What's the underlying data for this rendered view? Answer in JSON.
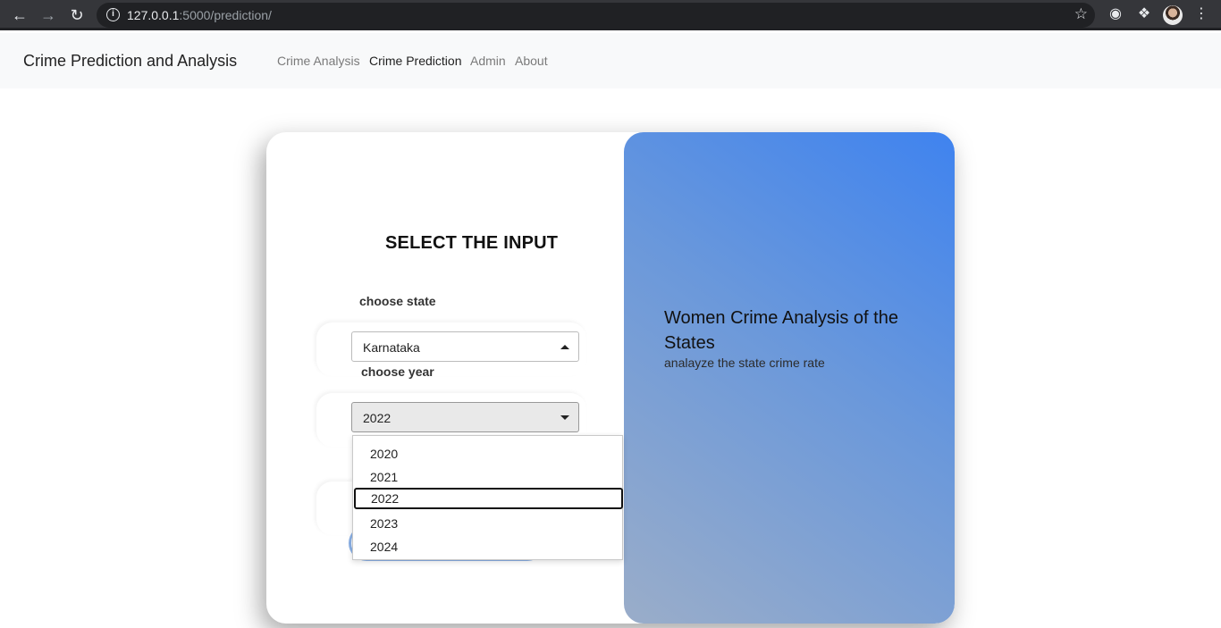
{
  "browser": {
    "url_host": "127.0.0.1",
    "url_path": ":5000/prediction/"
  },
  "navbar": {
    "brand": "Crime Prediction and Analysis",
    "links": [
      "Crime Analysis",
      "Crime Prediction",
      "Admin",
      "About"
    ],
    "active_link": "Crime Prediction"
  },
  "form": {
    "title": "SELECT THE INPUT",
    "state_label": "choose state",
    "state_value": "Karnataka",
    "year_label": "choose year",
    "year_value": "2022",
    "year_options": [
      "2020",
      "2021",
      "2022",
      "2023",
      "2024"
    ]
  },
  "info_panel": {
    "title": "Women Crime Analysis of the States",
    "subtitle": "analayze the state crime rate"
  }
}
